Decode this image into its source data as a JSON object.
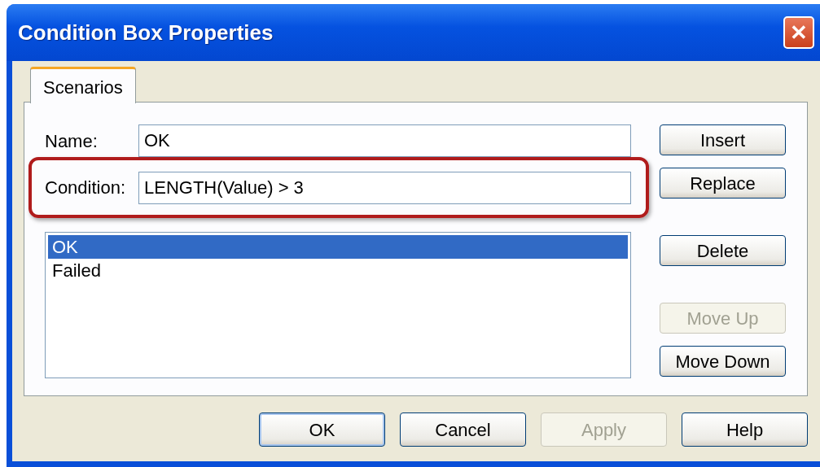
{
  "window": {
    "title": "Condition Box Properties",
    "close_glyph": "✕"
  },
  "tabs": [
    {
      "label": "Scenarios",
      "selected": true
    }
  ],
  "fields": [
    {
      "label": "Name:",
      "value": "OK",
      "highlighted": false
    },
    {
      "label": "Condition:",
      "value": "LENGTH(Value) > 3",
      "highlighted": true
    }
  ],
  "scenarios": [
    {
      "label": "OK",
      "selected": true
    },
    {
      "label": "Failed",
      "selected": false
    }
  ],
  "side_buttons": [
    {
      "label": "Insert",
      "disabled": false
    },
    {
      "label": "Replace",
      "disabled": false
    },
    {
      "label": "Delete",
      "disabled": false
    },
    {
      "label": "Move Up",
      "disabled": true
    },
    {
      "label": "Move Down",
      "disabled": false
    }
  ],
  "buttons": [
    {
      "label": "OK",
      "default": true,
      "disabled": false
    },
    {
      "label": "Cancel",
      "default": false,
      "disabled": false
    },
    {
      "label": "Apply",
      "default": false,
      "disabled": true
    },
    {
      "label": "Help",
      "default": false,
      "disabled": false
    }
  ]
}
